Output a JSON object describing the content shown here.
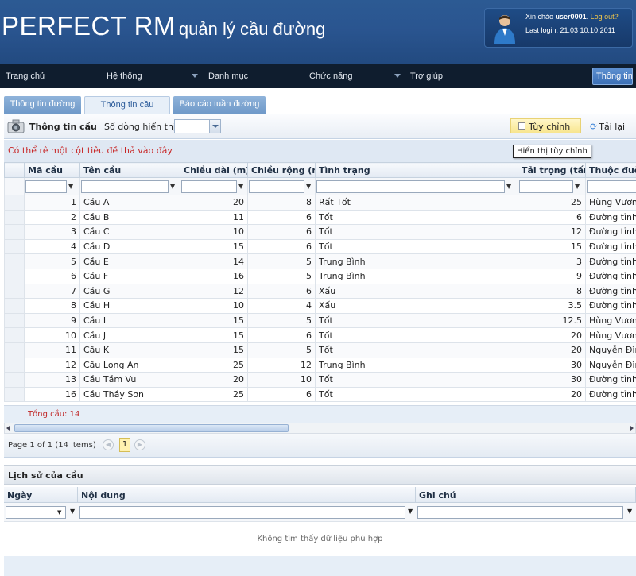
{
  "header": {
    "brand": "PERFECT RM",
    "subtitle": "quản lý cầu đường",
    "greeting": "Xin chào",
    "username": "user0001",
    "logout": "Log out?",
    "last_login": "Last login: 21:03 10.10.2011"
  },
  "nav": {
    "items": [
      "Trang chủ",
      "Hệ thống",
      "Danh mục",
      "Chức năng",
      "Trợ giúp"
    ],
    "info_button": "Thông tin"
  },
  "tabs": [
    "Thông tin đường",
    "Thông tin cầu",
    "Báo cáo tuần đường"
  ],
  "toolbar": {
    "title": "Thông tin cầu",
    "rows_label": "Số dòng hiển thị:",
    "custom_label": "Tùy chỉnh",
    "reload_label": "Tải lại",
    "tooltip": "Hiển thị tùy chỉnh"
  },
  "grid": {
    "drag_hint": "Có thể rê một cột tiêu đề thả vào đây",
    "columns": [
      "Mã cầu",
      "Tên cầu",
      "Chiều dài (m)",
      "Chiều rộng (m)",
      "Tình trạng",
      "Tải trọng (tấn)",
      "Thuộc đường"
    ],
    "rows": [
      [
        "1",
        "Cầu A",
        "20",
        "8",
        "Rất Tốt",
        "25",
        "Hùng Vương"
      ],
      [
        "2",
        "Cầu B",
        "11",
        "6",
        "Tốt",
        "6",
        "Đường tỉnh"
      ],
      [
        "3",
        "Cầu C",
        "10",
        "6",
        "Tốt",
        "12",
        "Đường tỉnh"
      ],
      [
        "4",
        "Cầu D",
        "15",
        "6",
        "Tốt",
        "15",
        "Đường tỉnh"
      ],
      [
        "5",
        "Cầu E",
        "14",
        "5",
        "Trung Bình",
        "3",
        "Đường tỉnh"
      ],
      [
        "6",
        "Cầu F",
        "16",
        "5",
        "Trung Bình",
        "9",
        "Đường tỉnh"
      ],
      [
        "7",
        "Cầu G",
        "12",
        "6",
        "Xấu",
        "8",
        "Đường tỉnh"
      ],
      [
        "8",
        "Cầu H",
        "10",
        "4",
        "Xấu",
        "3.5",
        "Đường tỉnh"
      ],
      [
        "9",
        "Cầu I",
        "15",
        "5",
        "Tốt",
        "12.5",
        "Hùng Vương"
      ],
      [
        "10",
        "Cầu J",
        "15",
        "6",
        "Tốt",
        "20",
        "Hùng Vương"
      ],
      [
        "11",
        "Cầu K",
        "15",
        "5",
        "Tốt",
        "20",
        "Nguyễn Đình"
      ],
      [
        "12",
        "Cầu Long An",
        "25",
        "12",
        "Trung Bình",
        "30",
        "Nguyễn Đình"
      ],
      [
        "13",
        "Cầu Tầm Vu",
        "20",
        "10",
        "Tốt",
        "30",
        "Đường tỉnh"
      ],
      [
        "16",
        "Cầu Thầy Sơn",
        "25",
        "6",
        "Tốt",
        "20",
        "Đường tỉnh"
      ]
    ],
    "total": "Tổng cầu: 14"
  },
  "pager": {
    "summary": "Page 1 of 1 (14 items)",
    "current_page": "1"
  },
  "history": {
    "title": "Lịch sử của cầu",
    "columns": [
      "Ngày",
      "Nội dung",
      "Ghi chú"
    ],
    "empty_text": "Không tìm thấy dữ liệu phù hợp"
  }
}
